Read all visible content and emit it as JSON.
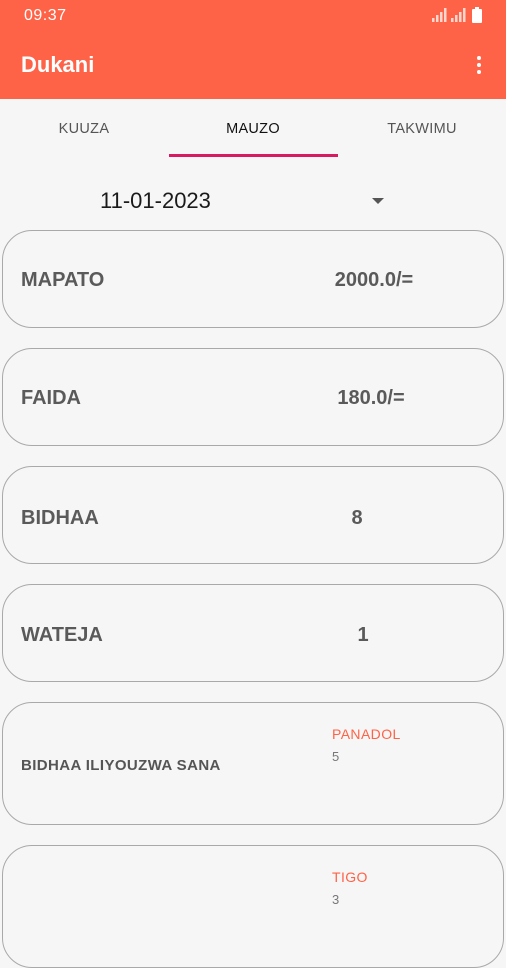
{
  "status_bar": {
    "time": "09:37"
  },
  "app_bar": {
    "title": "Dukani",
    "menu_icon": "more-vert-icon"
  },
  "tabs": [
    {
      "label": "KUUZA",
      "active": false
    },
    {
      "label": "MAUZO",
      "active": true
    },
    {
      "label": "TAKWIMU",
      "active": false
    }
  ],
  "date_selector": {
    "value": "11-01-2023"
  },
  "stats": [
    {
      "label": "MAPATO",
      "value": "2000.0/="
    },
    {
      "label": "FAIDA",
      "value": "180.0/="
    },
    {
      "label": "BIDHAA",
      "value": "8"
    },
    {
      "label": "WATEJA",
      "value": "1"
    }
  ],
  "top_items": [
    {
      "label": "BIDHAA ILIYOUZWA SANA",
      "product": "PANADOL",
      "quantity": "5"
    },
    {
      "label": "",
      "product": "TIGO",
      "quantity": "3"
    }
  ],
  "colors": {
    "accent": "#ff6347",
    "indicator": "#d81b60"
  }
}
